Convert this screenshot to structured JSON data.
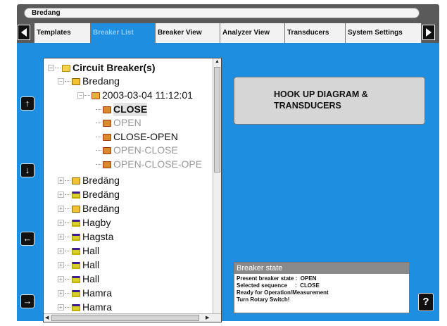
{
  "window": {
    "title": "Bredang"
  },
  "tabs": [
    {
      "label": "Templates",
      "active": false
    },
    {
      "label": "Breaker List",
      "active": true
    },
    {
      "label": "Breaker View",
      "active": false
    },
    {
      "label": "Analyzer View",
      "active": false
    },
    {
      "label": "Transducers",
      "active": false
    },
    {
      "label": "System Settings",
      "active": false
    }
  ],
  "nav": {
    "prev_icon": "arrow-left-icon",
    "next_icon": "arrow-right-icon"
  },
  "side_buttons": [
    {
      "name": "up",
      "glyph": "↑"
    },
    {
      "name": "down",
      "glyph": "↓"
    },
    {
      "name": "left",
      "glyph": "←"
    },
    {
      "name": "right",
      "glyph": "→"
    }
  ],
  "tree": {
    "root": {
      "label": "Circuit Breaker(s)",
      "expander": "−"
    },
    "items": [
      {
        "label": "Bredang",
        "expander": "−",
        "icon": "breaker"
      },
      {
        "label": "2003-03-04 11:12:01",
        "expander": "−",
        "icon": "test"
      },
      {
        "label": "CLOSE",
        "icon": "shot",
        "state": "selected"
      },
      {
        "label": "OPEN",
        "icon": "shot",
        "state": "disabled"
      },
      {
        "label": "CLOSE-OPEN",
        "icon": "shot",
        "state": "normal"
      },
      {
        "label": "OPEN-CLOSE",
        "icon": "shot",
        "state": "disabled"
      },
      {
        "label": "OPEN-CLOSE-OPE",
        "icon": "shot",
        "state": "disabled"
      },
      {
        "label": "Bredäng",
        "expander": "+",
        "icon": "breaker"
      },
      {
        "label": "Bredäng",
        "expander": "+",
        "icon": "plain"
      },
      {
        "label": "Bredäng",
        "expander": "+",
        "icon": "breaker"
      },
      {
        "label": "Hagby",
        "expander": "+",
        "icon": "plain"
      },
      {
        "label": "Hagsta",
        "expander": "+",
        "icon": "plain"
      },
      {
        "label": "Hall",
        "expander": "+",
        "icon": "plain"
      },
      {
        "label": "Hall",
        "expander": "+",
        "icon": "plain"
      },
      {
        "label": "Hall",
        "expander": "+",
        "icon": "plain"
      },
      {
        "label": "Hamra",
        "expander": "+",
        "icon": "plain"
      },
      {
        "label": "Hamra",
        "expander": "+",
        "icon": "plain"
      }
    ]
  },
  "hookup": {
    "label": "HOOK UP DIAGRAM & TRANSDUCERS"
  },
  "breaker_state": {
    "title": "Breaker state",
    "lines": [
      "Present breaker state :  OPEN",
      "Selected sequence     :  CLOSE",
      "Ready for Operation/Measurement",
      "Turn Rotary Switch!"
    ]
  },
  "help": {
    "label": "?"
  },
  "colors": {
    "panel_blue": "#1e8fe0",
    "frame_gray": "#5a5a5a"
  }
}
